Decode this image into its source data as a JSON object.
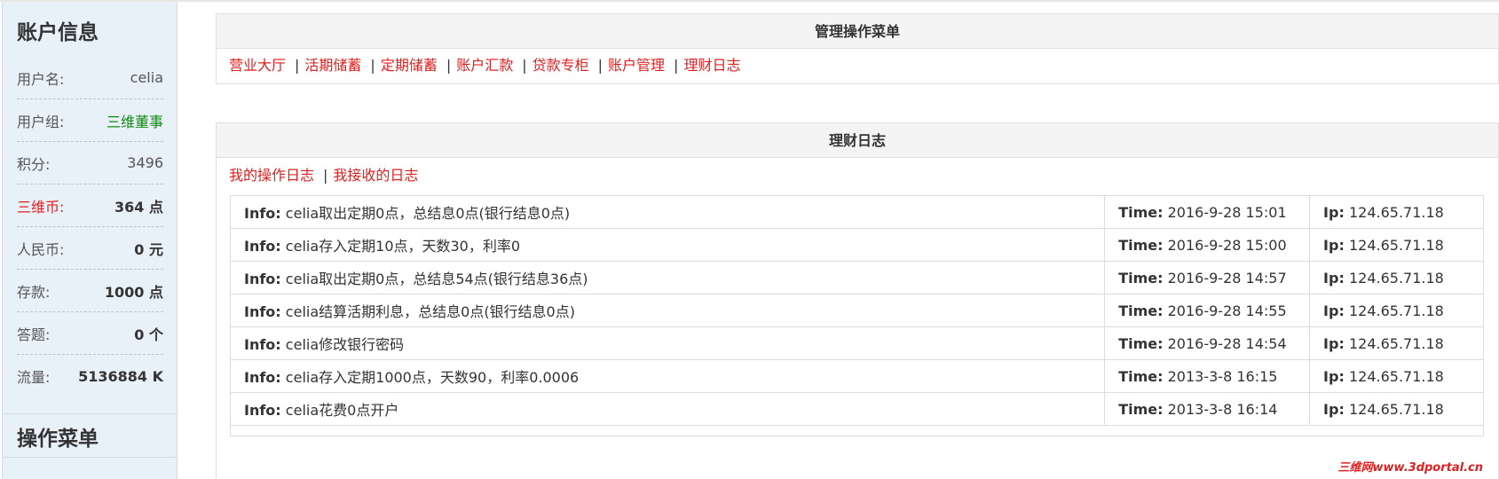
{
  "sidebar": {
    "title": "账户信息",
    "rows": [
      {
        "label": "用户名:",
        "value": "celia"
      },
      {
        "label": "用户组:",
        "value": "三维董事"
      },
      {
        "label": "积分:",
        "value": "3496"
      },
      {
        "label": "三维币:",
        "value": "364 点"
      },
      {
        "label": "人民币:",
        "value": "0 元"
      },
      {
        "label": "存款:",
        "value": "1000 点"
      },
      {
        "label": "答题:",
        "value": "0 个"
      },
      {
        "label": "流量:",
        "value": "5136884 K"
      }
    ],
    "menu_title": "操作菜单"
  },
  "manage_panel": {
    "title": "管理操作菜单",
    "links": [
      "营业大厅",
      "活期储蓄",
      "定期储蓄",
      "账户汇款",
      "贷款专柜",
      "账户管理",
      "理财日志"
    ],
    "separator": "|"
  },
  "log_panel": {
    "title": "理财日志",
    "tabs": [
      "我的操作日志",
      "我接收的日志"
    ],
    "info_label": "Info:",
    "time_label": "Time:",
    "ip_label": "Ip:",
    "rows": [
      {
        "info": "celia取出定期0点，总结息0点(银行结息0点)",
        "time": "2016-9-28 15:01",
        "ip": "124.65.71.18"
      },
      {
        "info": "celia存入定期10点，天数30，利率0",
        "time": "2016-9-28 15:00",
        "ip": "124.65.71.18"
      },
      {
        "info": "celia取出定期0点，总结息54点(银行结息36点)",
        "time": "2016-9-28 14:57",
        "ip": "124.65.71.18"
      },
      {
        "info": "celia结算活期利息，总结息0点(银行结息0点)",
        "time": "2016-9-28 14:55",
        "ip": "124.65.71.18"
      },
      {
        "info": "celia修改银行密码",
        "time": "2016-9-28 14:54",
        "ip": "124.65.71.18"
      },
      {
        "info": "celia存入定期1000点，天数90，利率0.0006",
        "time": "2013-3-8 16:15",
        "ip": "124.65.71.18"
      },
      {
        "info": "celia花费0点开户",
        "time": "2013-3-8 16:14",
        "ip": "124.65.71.18"
      }
    ]
  },
  "watermark": "三维网www.3dportal.cn",
  "colors": {
    "link": "#e02020",
    "group": "#138a13",
    "sidebar_bg": "#e8f0f8"
  }
}
